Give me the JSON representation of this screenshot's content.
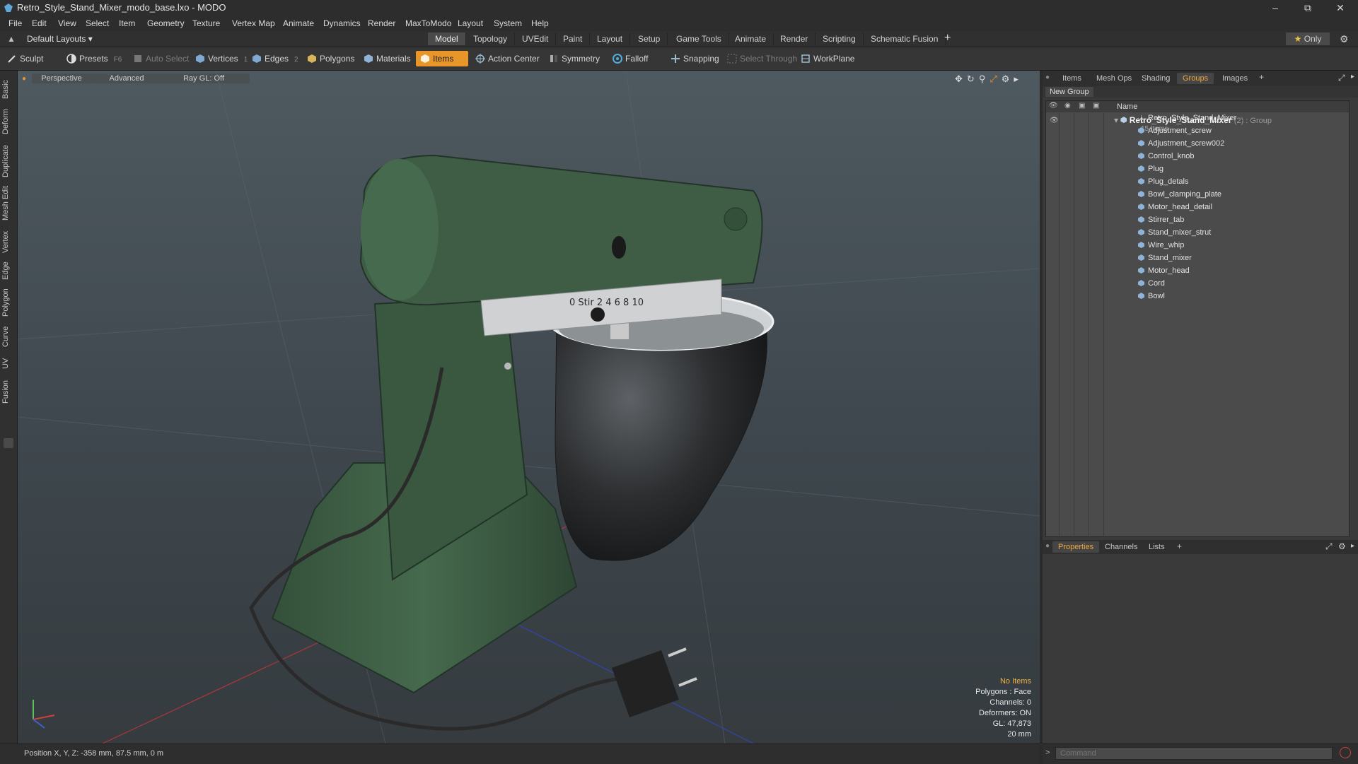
{
  "window": {
    "title": "Retro_Style_Stand_Mixer_modo_base.lxo - MODO",
    "controls": [
      "minimize-icon",
      "restore-icon",
      "close-icon"
    ]
  },
  "menu": [
    "File",
    "Edit",
    "View",
    "Select",
    "Item",
    "Geometry",
    "Texture",
    "Vertex Map",
    "Animate",
    "Dynamics",
    "Render",
    "MaxToModo",
    "Layout",
    "System",
    "Help"
  ],
  "layout_bar": {
    "preset": "Default Layouts",
    "tabs": [
      "Model",
      "Topology",
      "UVEdit",
      "Paint",
      "Layout",
      "Setup",
      "Game Tools",
      "Animate",
      "Render",
      "Scripting",
      "Schematic Fusion"
    ],
    "active_tab": "Model",
    "add": "+",
    "only_label": "Only"
  },
  "toolbar": {
    "sculpt": "Sculpt",
    "presets": "Presets",
    "presets_key": "F6",
    "auto_select": "Auto Select",
    "vertices": "Vertices",
    "vertices_num": "1",
    "edges": "Edges",
    "edges_num": "2",
    "polygons": "Polygons",
    "materials": "Materials",
    "items": "Items",
    "action_center": "Action Center",
    "symmetry": "Symmetry",
    "falloff": "Falloff",
    "snapping": "Snapping",
    "select_through": "Select Through",
    "workplane": "WorkPlane"
  },
  "left_tabs": [
    "Basic",
    "Deform",
    "Duplicate",
    "Mesh Edit",
    "Vertex",
    "Edge",
    "Polygon",
    "Curve",
    "UV",
    "Fusion"
  ],
  "viewport": {
    "view": "Perspective",
    "shading": "Advanced",
    "raygl": "Ray GL: Off",
    "info": {
      "selection": "No Items",
      "polygons": "Polygons : Face",
      "channels": "Channels: 0",
      "deformers": "Deformers: ON",
      "gl": "GL: 47,873",
      "scale": "20 mm"
    },
    "dial_numbers": "0 Stir 2 4 6 8 10"
  },
  "right_panel": {
    "tabs": [
      "Items",
      "Mesh Ops",
      "Shading",
      "Groups",
      "Images"
    ],
    "active_tab": "Groups",
    "new_group": "New Group",
    "column_name": "Name",
    "group": {
      "name": "Retro_Style_Stand_Mixer",
      "count_suffix": "(2) : Group",
      "items_label": "15 Items"
    },
    "items": [
      "Retro_Style_Stand_Mixer",
      "Adjustment_screw",
      "Adjustment_screw002",
      "Control_knob",
      "Plug",
      "Plug_detals",
      "Bowl_clamping_plate",
      "Motor_head_detail",
      "Stirrer_tab",
      "Stand_mixer_strut",
      "Wire_whip",
      "Stand_mixer",
      "Motor_head",
      "Cord",
      "Bowl"
    ],
    "lower_tabs": [
      "Properties",
      "Channels",
      "Lists"
    ],
    "lower_active": "Properties"
  },
  "status": {
    "position": "Position X, Y, Z:  -358 mm, 87.5 mm, 0 m"
  },
  "command": {
    "placeholder": "Command"
  },
  "colors": {
    "accent": "#e8952a",
    "mixer_green": "#3f5a44",
    "viewport_bg": "#49535a"
  }
}
